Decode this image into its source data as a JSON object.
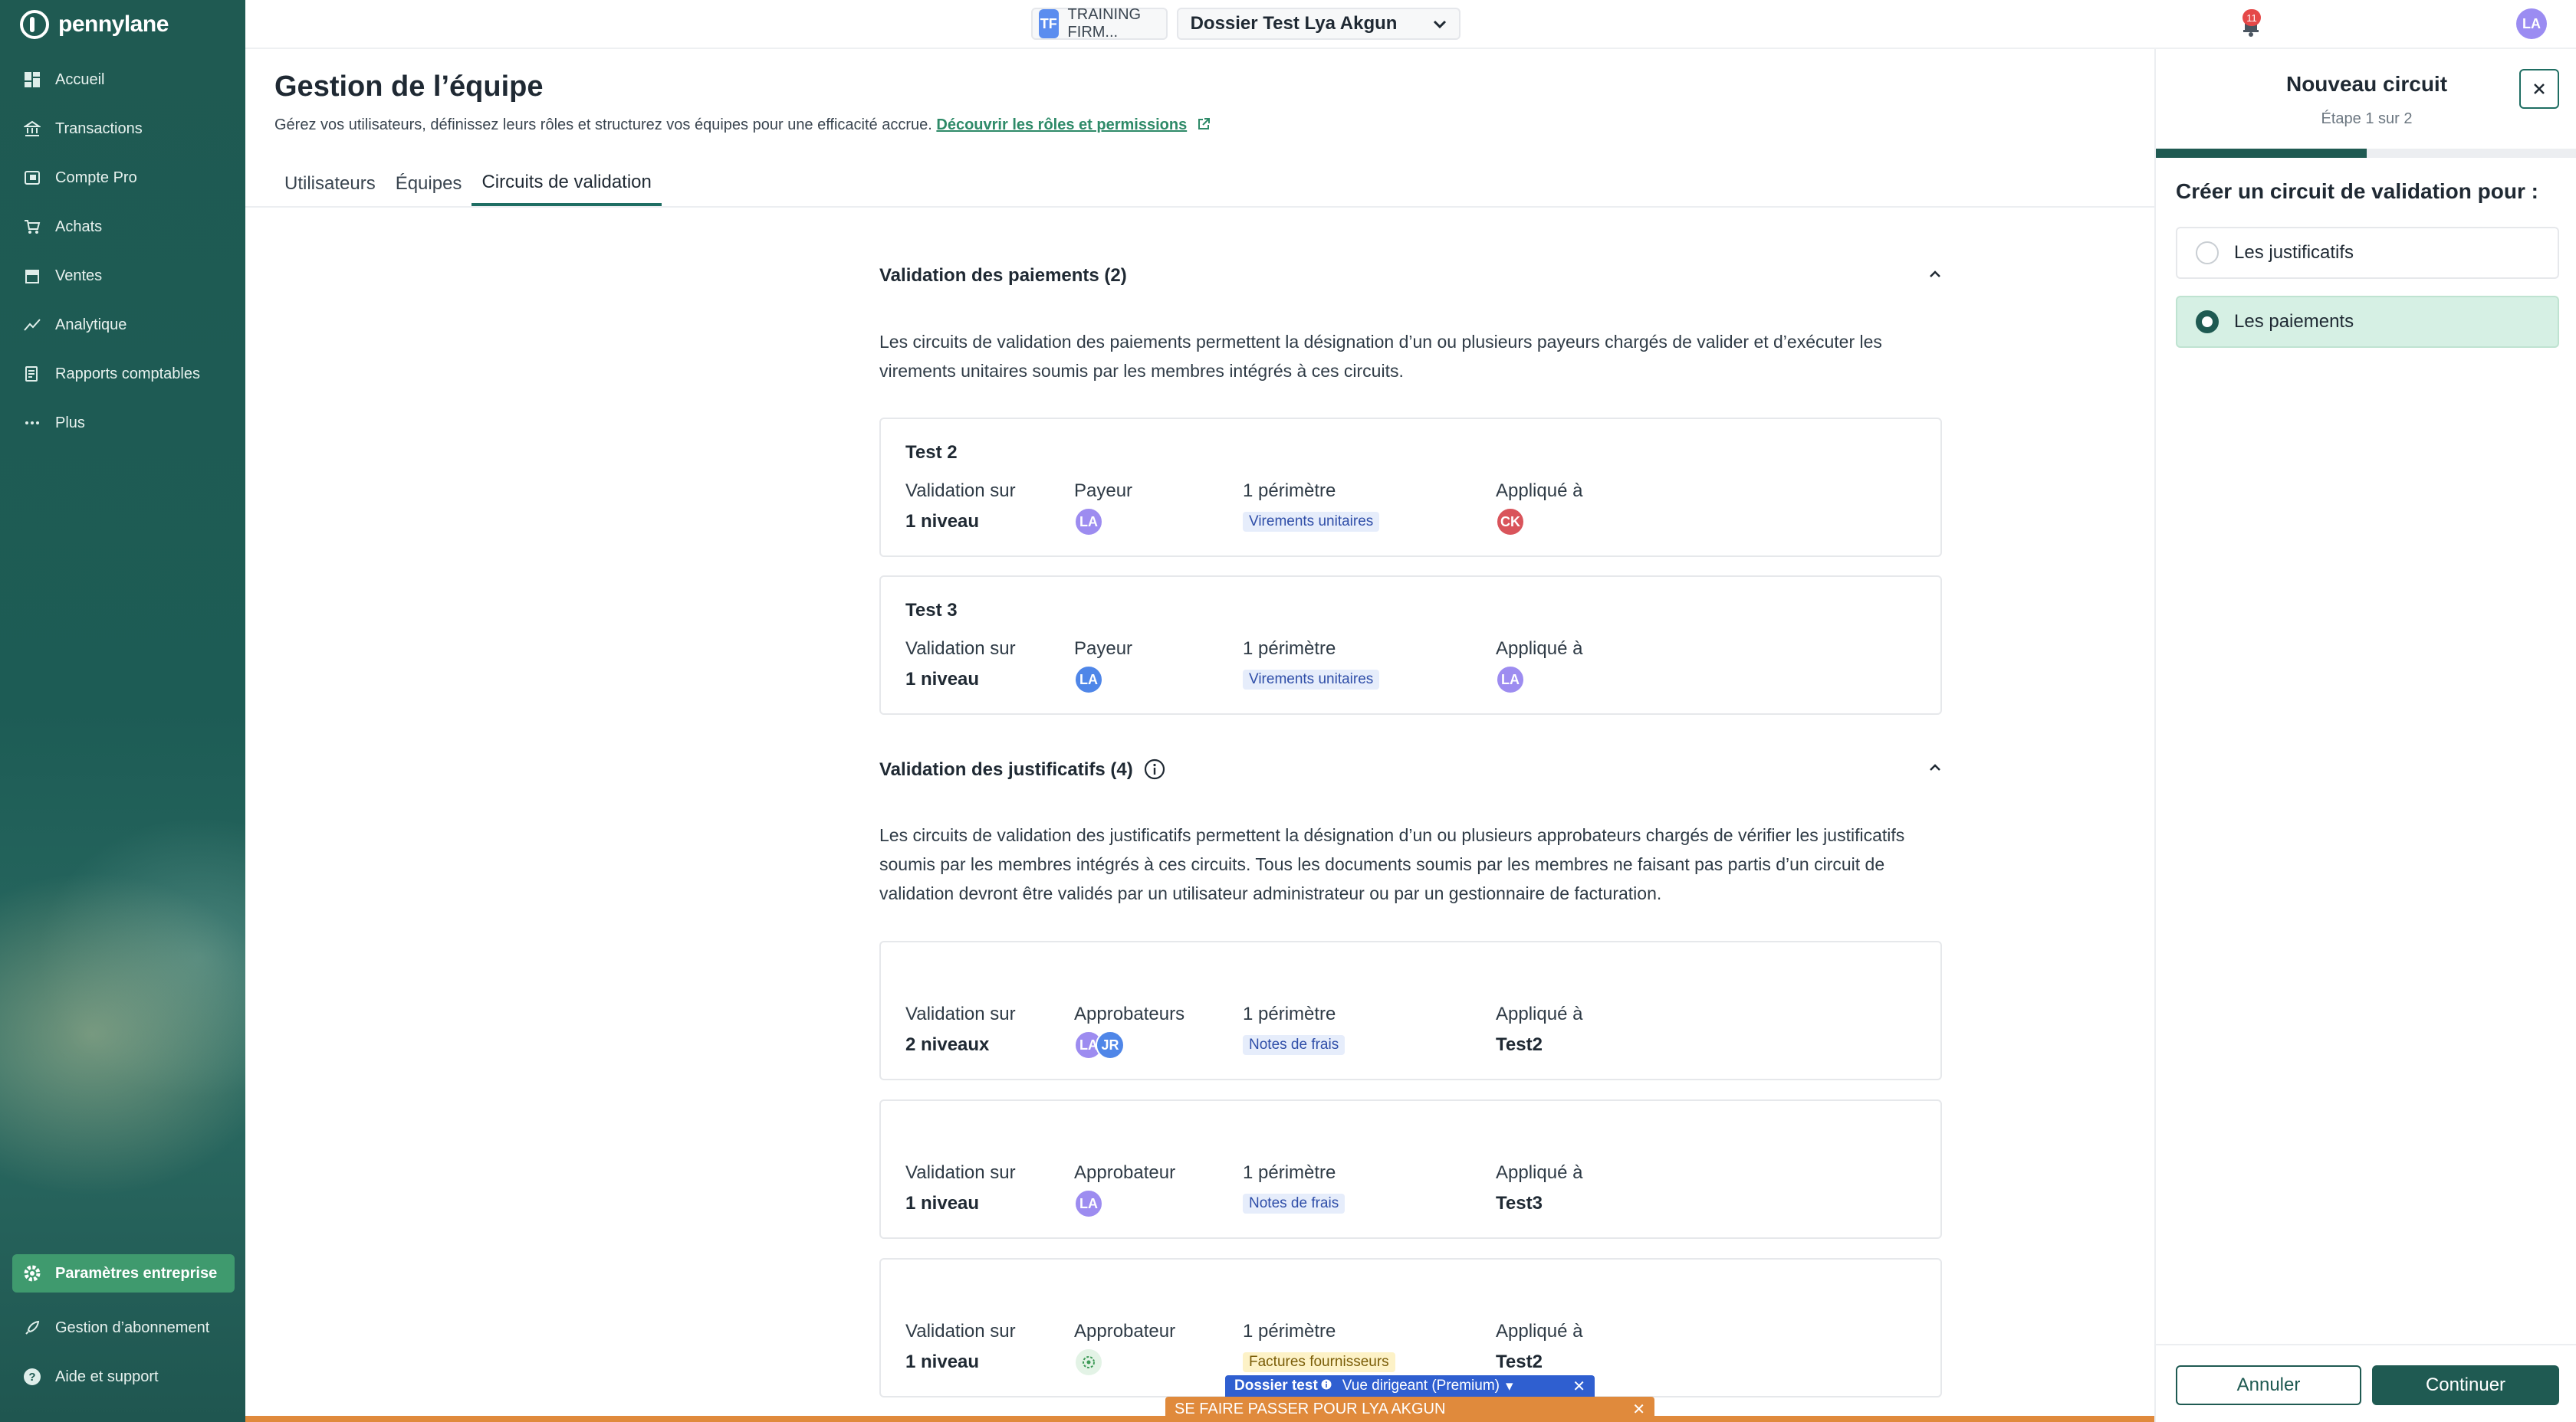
{
  "app": {
    "logo_text": "pennylane"
  },
  "sidebar": {
    "items": [
      {
        "label": "Accueil",
        "icon": "dashboard-icon"
      },
      {
        "label": "Transactions",
        "icon": "bank-icon"
      },
      {
        "label": "Compte Pro",
        "icon": "wallet-icon"
      },
      {
        "label": "Achats",
        "icon": "cart-icon"
      },
      {
        "label": "Ventes",
        "icon": "shop-icon"
      },
      {
        "label": "Analytique",
        "icon": "chart-line-icon"
      },
      {
        "label": "Rapports comptables",
        "icon": "report-icon"
      },
      {
        "label": "Plus",
        "icon": "more-dots-icon"
      }
    ],
    "bottom": [
      {
        "label": "Paramètres entreprise",
        "icon": "gear-icon",
        "active": true
      },
      {
        "label": "Gestion d’abonnement",
        "icon": "rocket-icon"
      },
      {
        "label": "Aide et support",
        "icon": "help-icon"
      }
    ]
  },
  "topbar": {
    "firm_badge": "TF",
    "firm_name": "TRAINING FIRM...",
    "dossier": "Dossier Test Lya Akgun",
    "notifications": "11",
    "user_initials": "LA"
  },
  "header": {
    "title": "Gestion de l’équipe",
    "subtitle": "Gérez vos utilisateurs, définissez leurs rôles et structurez vos équipes pour une efficacité accrue.",
    "link": "Découvrir les rôles et permissions",
    "tabs": [
      {
        "label": "Utilisateurs"
      },
      {
        "label": "Équipes"
      },
      {
        "label": "Circuits de validation",
        "active": true
      }
    ]
  },
  "payments": {
    "heading": "Validation des paiements (2)",
    "description": "Les circuits de validation des paiements permettent la désignation d’un ou plusieurs payeurs chargés de valider et d’exécuter les virements unitaires soumis par les membres intégrés à ces circuits.",
    "circuits": [
      {
        "title": "Test 2",
        "levels_label": "Validation sur",
        "levels": "1 niveau",
        "role_label": "Payeur",
        "role_avatars": [
          "LA"
        ],
        "scope_label": "1 périmètre",
        "scope_tag": "Virements unitaires",
        "applied_label": "Appliqué à",
        "applied_avatars": [
          "CK"
        ]
      },
      {
        "title": "Test 3",
        "levels_label": "Validation sur",
        "levels": "1 niveau",
        "role_label": "Payeur",
        "role_avatars": [
          "LA"
        ],
        "scope_label": "1 périmètre",
        "scope_tag": "Virements unitaires",
        "applied_label": "Appliqué à",
        "applied_avatars": [
          "LA"
        ]
      }
    ]
  },
  "documents": {
    "heading": "Validation des justificatifs (4)",
    "description": "Les circuits de validation des justificatifs permettent la désignation d’un ou plusieurs approbateurs chargés de vérifier les justificatifs soumis par les membres intégrés à ces circuits. Tous les documents soumis par les membres ne faisant pas partis d’un circuit de validation devront être validés par un utilisateur administrateur ou par un gestionnaire de facturation.",
    "circuits": [
      {
        "levels_label": "Validation sur",
        "levels": "2 niveaux",
        "role_label": "Approbateurs",
        "role_avatars": [
          "LA",
          "JR"
        ],
        "scope_label": "1 périmètre",
        "scope_tag": "Notes de frais",
        "applied_label": "Appliqué à",
        "applied_value": "Test2"
      },
      {
        "levels_label": "Validation sur",
        "levels": "1 niveau",
        "role_label": "Approbateur",
        "role_avatars": [
          "LA"
        ],
        "scope_label": "1 périmètre",
        "scope_tag": "Notes de frais",
        "applied_label": "Appliqué à",
        "applied_value": "Test3"
      },
      {
        "levels_label": "Validation sur",
        "levels": "1 niveau",
        "role_label": "Approbateur",
        "role_avatars": [],
        "scope_label": "1 périmètre",
        "scope_tag": "Factures fournisseurs",
        "applied_label": "Appliqué à",
        "applied_value": "Test2"
      }
    ]
  },
  "panel": {
    "title": "Nouveau circuit",
    "step": "Étape 1 sur 2",
    "progress": 0.5,
    "question": "Créer un circuit de validation pour :",
    "options": [
      {
        "label": "Les justificatifs",
        "selected": false
      },
      {
        "label": "Les paiements",
        "selected": true
      }
    ],
    "cancel": "Annuler",
    "continue": "Continuer"
  },
  "banners": {
    "dossier_label": "Dossier test",
    "view_mode": "Vue dirigeant (Premium)",
    "impersonate": "SE FAIRE PASSER POUR LYA AKGUN"
  },
  "colors": {
    "brand": "#1f5a52",
    "accent_green": "#3f9a6e",
    "banner_blue": "#2f5fd0",
    "banner_orange": "#e08a3c"
  }
}
